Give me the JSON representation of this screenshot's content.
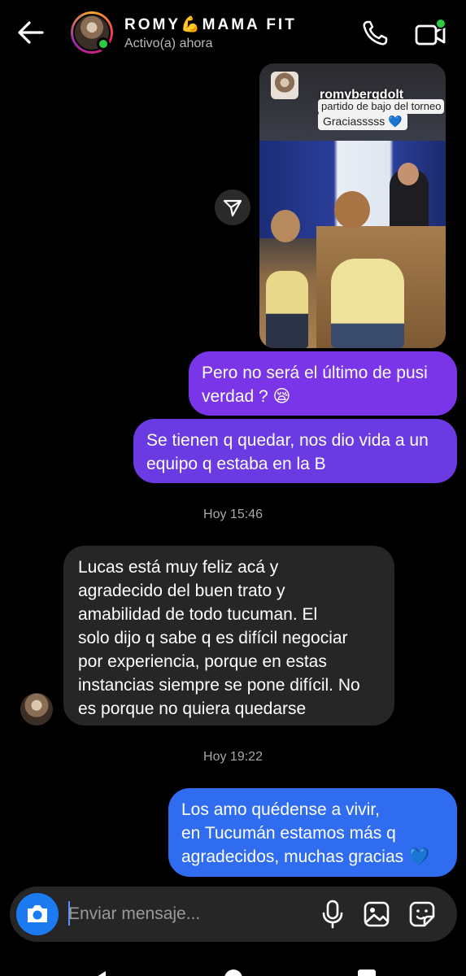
{
  "header": {
    "contact_name": "ROMY💪MAMA FIT",
    "status": "Activo(a) ahora",
    "icons": [
      "back-arrow-icon",
      "phone-icon",
      "video-call-icon"
    ]
  },
  "shared_post": {
    "username": "romybergdolt",
    "caption_line1": "partido de bajo del torneo",
    "caption_line2": "Graciasssss 💙"
  },
  "messages": [
    {
      "from": "me",
      "lines": [
        "Pero no será el último de pusi",
        "verdad ? 😪"
      ]
    },
    {
      "from": "me",
      "lines": [
        "Se tienen q quedar, nos dio vida a un",
        "equipo q estaba en la B"
      ]
    },
    {
      "from": "them",
      "lines": [
        "Lucas está muy feliz acá y",
        "agradecido del buen trato y",
        "amabilidad de todo tucuman. El",
        "solo dijo q sabe q es difícil negociar",
        "por experiencia, porque en estas",
        "instancias siempre se pone difícil. No",
        "es porque no quiera quedarse"
      ]
    },
    {
      "from": "me",
      "lines": [
        "Los amo quédense a vivir,",
        "en Tucumán estamos más q",
        "agradecidos, muchas gracias 💙"
      ]
    }
  ],
  "timestamps": [
    "Hoy 15:46",
    "Hoy 19:22"
  ],
  "composer": {
    "placeholder": "Enviar mensaje...",
    "icons": [
      "camera-icon",
      "microphone-icon",
      "gallery-icon",
      "sticker-icon"
    ]
  },
  "colors": {
    "bubble_purple": "#7a35e8",
    "bubble_violet": "#6a3ae3",
    "bubble_blue": "#2f6cf0",
    "bubble_gray": "#262626",
    "camera_blue": "#1d7bf2",
    "online_green": "#2ecc40"
  }
}
